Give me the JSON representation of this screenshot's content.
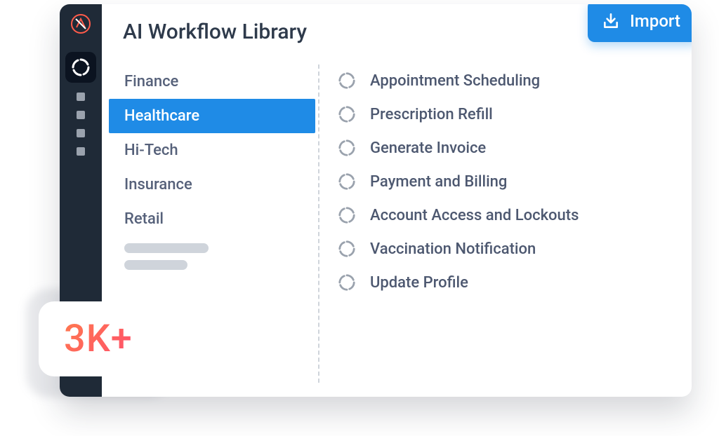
{
  "header": {
    "title": "AI Workflow Library",
    "import_label": "Import"
  },
  "categories": {
    "items": [
      {
        "label": "Finance",
        "active": false
      },
      {
        "label": "Healthcare",
        "active": true
      },
      {
        "label": "Hi-Tech",
        "active": false
      },
      {
        "label": "Insurance",
        "active": false
      },
      {
        "label": "Retail",
        "active": false
      }
    ]
  },
  "workflows": {
    "items": [
      {
        "label": "Appointment Scheduling"
      },
      {
        "label": "Prescription Refill"
      },
      {
        "label": "Generate Invoice"
      },
      {
        "label": "Payment and Billing"
      },
      {
        "label": "Account Access and Lockouts"
      },
      {
        "label": "Vaccination Notification"
      },
      {
        "label": "Update Profile"
      }
    ]
  },
  "badge": {
    "value": "3K+"
  },
  "colors": {
    "accent": "#1f8be6",
    "rail": "#1f2a37",
    "text": "#4d5870",
    "badge_gradient_start": "#ff7a4e",
    "badge_gradient_end": "#ff4f6d"
  }
}
